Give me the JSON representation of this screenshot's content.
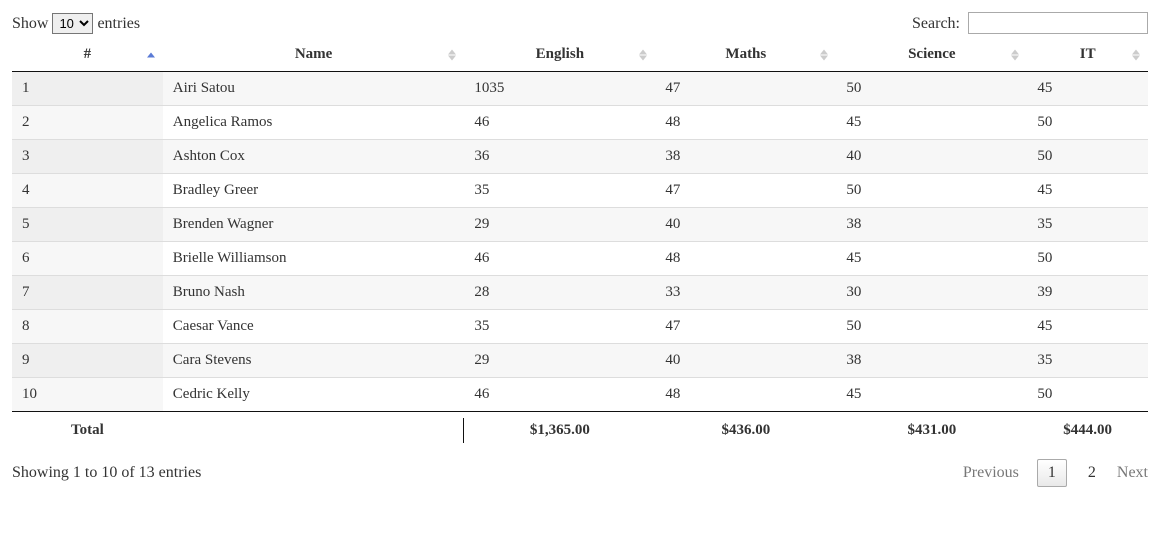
{
  "length": {
    "show_label": "Show",
    "entries_label": "entries",
    "selected": "10"
  },
  "search": {
    "label": "Search:",
    "value": ""
  },
  "columns": {
    "index": "#",
    "name": "Name",
    "english": "English",
    "maths": "Maths",
    "science": "Science",
    "it": "IT"
  },
  "rows": [
    {
      "idx": "1",
      "name": "Airi Satou",
      "english": "1035",
      "maths": "47",
      "science": "50",
      "it": "45"
    },
    {
      "idx": "2",
      "name": "Angelica Ramos",
      "english": "46",
      "maths": "48",
      "science": "45",
      "it": "50"
    },
    {
      "idx": "3",
      "name": "Ashton Cox",
      "english": "36",
      "maths": "38",
      "science": "40",
      "it": "50"
    },
    {
      "idx": "4",
      "name": "Bradley Greer",
      "english": "35",
      "maths": "47",
      "science": "50",
      "it": "45"
    },
    {
      "idx": "5",
      "name": "Brenden Wagner",
      "english": "29",
      "maths": "40",
      "science": "38",
      "it": "35"
    },
    {
      "idx": "6",
      "name": "Brielle Williamson",
      "english": "46",
      "maths": "48",
      "science": "45",
      "it": "50"
    },
    {
      "idx": "7",
      "name": "Bruno Nash",
      "english": "28",
      "maths": "33",
      "science": "30",
      "it": "39"
    },
    {
      "idx": "8",
      "name": "Caesar Vance",
      "english": "35",
      "maths": "47",
      "science": "50",
      "it": "45"
    },
    {
      "idx": "9",
      "name": "Cara Stevens",
      "english": "29",
      "maths": "40",
      "science": "38",
      "it": "35"
    },
    {
      "idx": "10",
      "name": "Cedric Kelly",
      "english": "46",
      "maths": "48",
      "science": "45",
      "it": "50"
    }
  ],
  "footer": {
    "total_label": "Total",
    "english": "$1,365.00",
    "maths": "$436.00",
    "science": "$431.00",
    "it": "$444.00"
  },
  "info": "Showing 1 to 10 of 13 entries",
  "paginate": {
    "previous": "Previous",
    "next": "Next",
    "pages": [
      "1",
      "2"
    ],
    "current": "1"
  }
}
